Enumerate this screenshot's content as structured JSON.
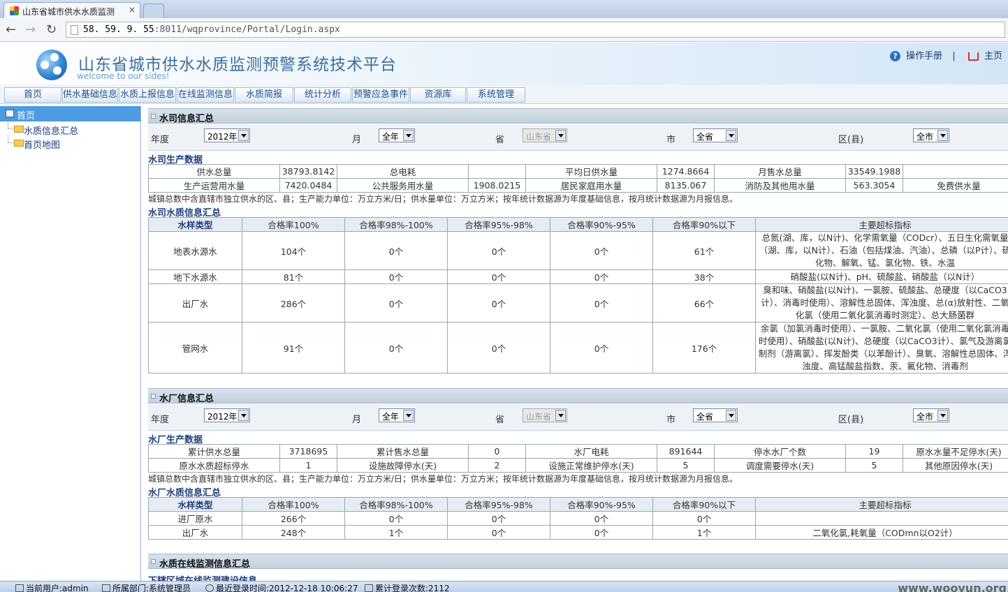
{
  "browser": {
    "tab_title": "山东省城市供水水质监测",
    "tab_close": "×",
    "url_host": "58. 59. 9. 55",
    "url_rest": ":8011/wqprovince/Portal/Login.aspx"
  },
  "header": {
    "title": "山东省城市供水水质监测预警系统技术平台",
    "subtitle": "welcome to our sides!",
    "manual": "操作手册",
    "sep": "|",
    "home": "主页"
  },
  "menu": [
    "首页",
    "供水基础信息",
    "水质上报信息",
    "在线监测信息",
    "水质简报",
    "统计分析",
    "预警应急事件",
    "资源库",
    "系统管理"
  ],
  "sidebar": {
    "head": "首页",
    "items": [
      "水质信息汇总",
      "首页地图"
    ]
  },
  "filter_labels": {
    "year": "年度",
    "month": "月",
    "province": "省",
    "city": "市",
    "district": "区(县)"
  },
  "filter_values": {
    "year": "2012年",
    "month": "全年",
    "province": "山东省",
    "city": "全省",
    "district": "全市"
  },
  "section1": {
    "title": "水司信息汇总",
    "prod_title": "水司生产数据",
    "prod_rows": [
      [
        "供水总量",
        "38793.8142",
        "总电耗",
        "",
        "平均日供水量",
        "1274.8664",
        "月售水总量",
        "33549.1988",
        ""
      ],
      [
        "生产运营用水量",
        "7420.0484",
        "公共服务用水量",
        "1908.0215",
        "居民家庭用水量",
        "8135.067",
        "消防及其他用水量",
        "563.3054",
        "免费供水量"
      ]
    ],
    "note": "城镇总数中含直辖市独立供水的区、县；生产能力单位：万立方米/日；供水量单位：万立方米；按年统计数据源为年度基础信息，按月统计数据源为月报信息。",
    "quality_title": "水司水质信息汇总",
    "quality_header": [
      "水样类型",
      "合格率100%",
      "合格率98%-100%",
      "合格率95%-98%",
      "合格率90%-95%",
      "合格率90%以下",
      "主要超标指标"
    ],
    "quality_rows": [
      [
        "地表水源水",
        "104个",
        "0个",
        "0个",
        "0个",
        "61个",
        "总氮(湖、库，以N计)、化学需氧量（CODcr）、五日生化需氧量（湖、库，以N计）、石油（包括煤油、汽油）、总磷（以P计）、硫化物、解氧、锰、氯化物、铁、水温"
      ],
      [
        "地下水源水",
        "81个",
        "0个",
        "0个",
        "0个",
        "38个",
        "硝酸盐(以N计)、pH、硫酸盐、硝酸盐（以N计）"
      ],
      [
        "出厂水",
        "286个",
        "0个",
        "0个",
        "0个",
        "66个",
        "臭和味、硝酸盐(以N计)、一氯胺、硫酸盐、总硬度（以CaCO3计）、消毒时使用）、溶解性总固体、浑浊度、总(α)放射性、二氧化氯（使用二氧化氯消毒时测定）、总大肠菌群"
      ],
      [
        "管网水",
        "91个",
        "0个",
        "0个",
        "0个",
        "176个",
        "余氯（加氯消毒时使用）、一氯胺、二氧化氯（使用二氧化氯消毒时使用）、硝酸盐(以N计)、总硬度（以CaCO3计）、氯气及游离氯制剂（游离氯）、挥发酚类（以苯酚计）、臭氧、溶解性总固体、浑浊度、高锰酸盐指数、汞、氟化物、消毒剂"
      ]
    ]
  },
  "section2": {
    "title": "水厂信息汇总",
    "prod_title": "水厂生产数据",
    "prod_rows": [
      [
        "累计供水总量",
        "3718695",
        "累计售水总量",
        "0",
        "水厂电耗",
        "891644",
        "停水水厂个数",
        "19",
        "原水水量不足停水(天)"
      ],
      [
        "原水水质超标停水",
        "1",
        "设施故障停水(天)",
        "2",
        "设施正常维护停水(天)",
        "5",
        "调度需要停水(天)",
        "5",
        "其他原因停水(天)"
      ]
    ],
    "note": "城镇总数中含直辖市独立供水的区、县；生产能力单位：万立方米/日；供水量单位：万立方米；按年统计数据源为年度基础信息，按月统计数据源为月报信息。",
    "quality_title": "水厂水质信息汇总",
    "quality_header": [
      "水样类型",
      "合格率100%",
      "合格率98%-100%",
      "合格率95%-98%",
      "合格率90%-95%",
      "合格率90%以下",
      "主要超标指标"
    ],
    "quality_rows": [
      [
        "进厂原水",
        "266个",
        "0个",
        "0个",
        "0个",
        "0个",
        ""
      ],
      [
        "出厂水",
        "248个",
        "1个",
        "0个",
        "0个",
        "1个",
        "二氧化氯,耗氧量（CODmn以O2计）"
      ]
    ]
  },
  "section3": {
    "title": "水质在线监测信息汇总",
    "sub": "下辖区域在线监测建设信息"
  },
  "status": {
    "user": "当前用户:admin",
    "dept": "所属部门:系统管理员",
    "last_login": "最近登录时间:2012-12-18 10:06:27",
    "count": "累计登录次数:2112",
    "watermark": "www.wooyun.org"
  }
}
